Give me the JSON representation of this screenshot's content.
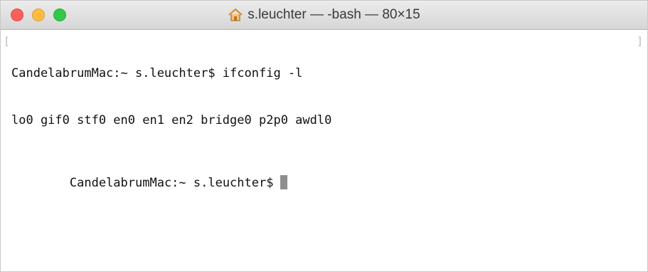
{
  "window": {
    "title": "s.leuchter — -bash — 80×15",
    "title_icon": "home-icon",
    "controls": {
      "close": "close-button",
      "minimize": "minimize-button",
      "zoom": "zoom-button"
    }
  },
  "terminal": {
    "lines": [
      "CandelabrumMac:~ s.leuchter$ ifconfig -l",
      "lo0 gif0 stf0 en0 en1 en2 bridge0 p2p0 awdl0"
    ],
    "prompt": "CandelabrumMac:~ s.leuchter$"
  },
  "colors": {
    "close": "#fc605c",
    "minimize": "#fdbc40",
    "zoom": "#34c84a",
    "cursor": "#8e8e8e"
  }
}
